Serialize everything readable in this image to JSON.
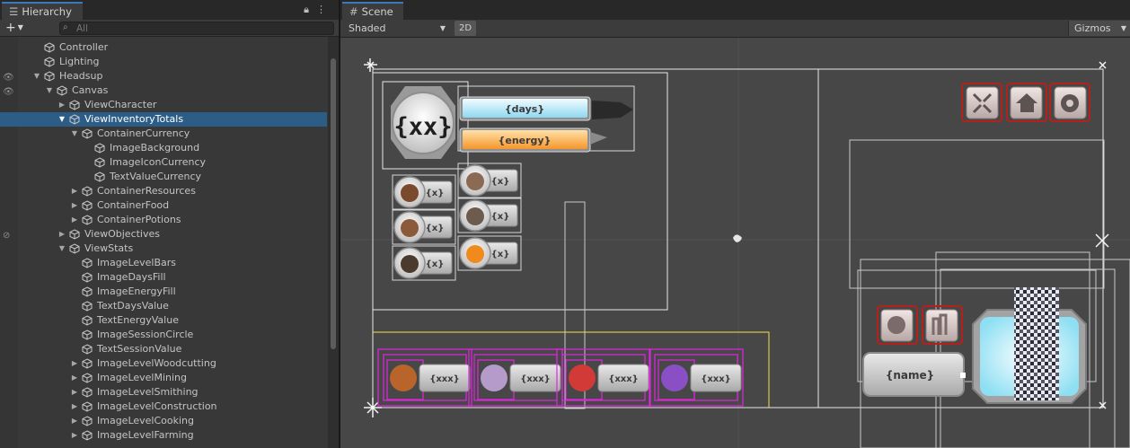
{
  "hierarchy": {
    "tab_label": "Hierarchy",
    "tab_icon": "list-icon",
    "add_label": "+",
    "search": {
      "placeholder": "All"
    },
    "items": [
      {
        "label": "Controller",
        "depth": 3,
        "expand": "none",
        "selected": false
      },
      {
        "label": "Lighting",
        "depth": 3,
        "expand": "none",
        "selected": false
      },
      {
        "label": "Headsup",
        "depth": 3,
        "expand": "open",
        "selected": false
      },
      {
        "label": "Canvas",
        "depth": 4,
        "expand": "open",
        "selected": false
      },
      {
        "label": "ViewCharacter",
        "depth": 5,
        "expand": "closed",
        "selected": false
      },
      {
        "label": "ViewInventoryTotals",
        "depth": 5,
        "expand": "open",
        "selected": true
      },
      {
        "label": "ContainerCurrency",
        "depth": 6,
        "expand": "open",
        "selected": false
      },
      {
        "label": "ImageBackground",
        "depth": 7,
        "expand": "none",
        "selected": false
      },
      {
        "label": "ImageIconCurrency",
        "depth": 7,
        "expand": "none",
        "selected": false
      },
      {
        "label": "TextValueCurrency",
        "depth": 7,
        "expand": "none",
        "selected": false
      },
      {
        "label": "ContainerResources",
        "depth": 6,
        "expand": "closed",
        "selected": false
      },
      {
        "label": "ContainerFood",
        "depth": 6,
        "expand": "closed",
        "selected": false
      },
      {
        "label": "ContainerPotions",
        "depth": 6,
        "expand": "closed",
        "selected": false
      },
      {
        "label": "ViewObjectives",
        "depth": 5,
        "expand": "closed",
        "selected": false
      },
      {
        "label": "ViewStats",
        "depth": 5,
        "expand": "open",
        "selected": false
      },
      {
        "label": "ImageLevelBars",
        "depth": 6,
        "expand": "none",
        "selected": false
      },
      {
        "label": "ImageDaysFill",
        "depth": 6,
        "expand": "none",
        "selected": false
      },
      {
        "label": "ImageEnergyFill",
        "depth": 6,
        "expand": "none",
        "selected": false
      },
      {
        "label": "TextDaysValue",
        "depth": 6,
        "expand": "none",
        "selected": false
      },
      {
        "label": "TextEnergyValue",
        "depth": 6,
        "expand": "none",
        "selected": false
      },
      {
        "label": "ImageSessionCircle",
        "depth": 6,
        "expand": "none",
        "selected": false
      },
      {
        "label": "TextSessionValue",
        "depth": 6,
        "expand": "none",
        "selected": false
      },
      {
        "label": "ImageLevelWoodcutting",
        "depth": 6,
        "expand": "closed",
        "selected": false
      },
      {
        "label": "ImageLevelMining",
        "depth": 6,
        "expand": "closed",
        "selected": false
      },
      {
        "label": "ImageLevelSmithing",
        "depth": 6,
        "expand": "closed",
        "selected": false
      },
      {
        "label": "ImageLevelConstruction",
        "depth": 6,
        "expand": "closed",
        "selected": false
      },
      {
        "label": "ImageLevelCooking",
        "depth": 6,
        "expand": "closed",
        "selected": false
      },
      {
        "label": "ImageLevelFarming",
        "depth": 6,
        "expand": "closed",
        "selected": false
      }
    ]
  },
  "scene": {
    "tab_label": "Scene",
    "tab_icon": "grid-icon",
    "shading_mode": "Shaded",
    "mode_2d_label": "2D",
    "gizmos_label": "Gizmos",
    "hud": {
      "session_label": "{xx}",
      "days_label": "{days}",
      "energy_label": "{energy}",
      "resource_labels": [
        "{x}",
        "{x}",
        "{x}",
        "{x}",
        "{x}",
        "{x}"
      ],
      "inventory_labels": [
        "{xxx}",
        "{xxx}",
        "{xxx}",
        "{xxx}"
      ],
      "name_label": "{name}"
    },
    "colors": {
      "days_fill": "#bfefff",
      "energy_fill": "#ffb14a",
      "selection_magenta": "#e225e2",
      "selection_yellow": "#f0e24a",
      "menu_button_border": "#b3211d"
    }
  }
}
